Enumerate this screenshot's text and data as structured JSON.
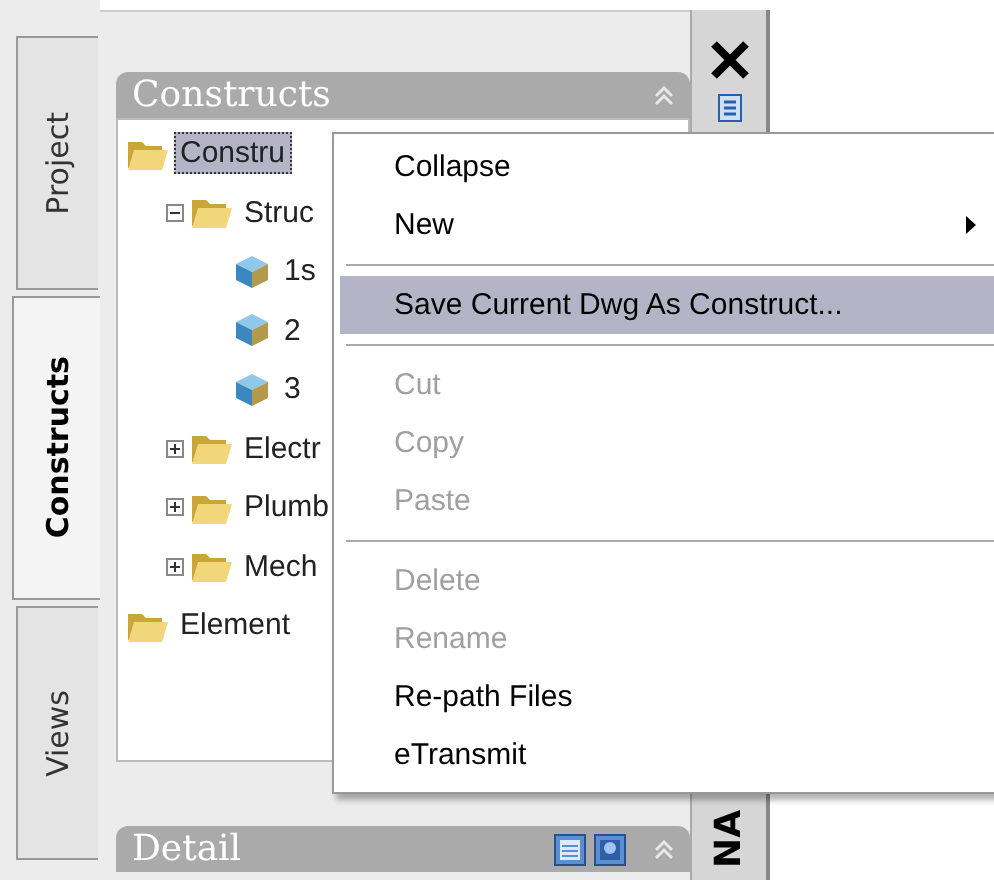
{
  "side_tabs": [
    {
      "label": "Project",
      "selected": false
    },
    {
      "label": "Constructs",
      "selected": true
    },
    {
      "label": "Views",
      "selected": false
    }
  ],
  "constructs_panel": {
    "title": "Constructs",
    "tree": [
      {
        "label": "Constru",
        "kind": "folder",
        "selected": true,
        "children": [
          {
            "label": "Struc",
            "kind": "folder",
            "selected": false,
            "expanded": true,
            "children": [
              {
                "label": "1s",
                "kind": "construct",
                "selected": false
              },
              {
                "label": "2",
                "kind": "construct",
                "selected": false
              },
              {
                "label": "3",
                "kind": "construct",
                "selected": false
              }
            ]
          },
          {
            "label": "Electr",
            "kind": "folder",
            "selected": false,
            "expanded": false
          },
          {
            "label": "Plumb",
            "kind": "folder",
            "selected": false,
            "expanded": false
          },
          {
            "label": "Mech",
            "kind": "folder",
            "selected": false,
            "expanded": false
          }
        ]
      },
      {
        "label": "Element",
        "kind": "folder",
        "selected": false
      }
    ]
  },
  "detail_panel": {
    "title": "Detail"
  },
  "side_strip": {
    "label": "NA"
  },
  "context_menu": [
    {
      "kind": "item",
      "label": "Collapse",
      "disabled": false,
      "selected": false
    },
    {
      "kind": "item",
      "label": "New",
      "disabled": false,
      "selected": false,
      "submenu": true
    },
    {
      "kind": "separator"
    },
    {
      "kind": "item",
      "label": "Save Current Dwg As Construct...",
      "disabled": false,
      "selected": true
    },
    {
      "kind": "separator"
    },
    {
      "kind": "item",
      "label": "Cut",
      "disabled": true,
      "selected": false
    },
    {
      "kind": "item",
      "label": "Copy",
      "disabled": true,
      "selected": false
    },
    {
      "kind": "item",
      "label": "Paste",
      "disabled": true,
      "selected": false
    },
    {
      "kind": "separator"
    },
    {
      "kind": "item",
      "label": "Delete",
      "disabled": true,
      "selected": false
    },
    {
      "kind": "item",
      "label": "Rename",
      "disabled": true,
      "selected": false
    },
    {
      "kind": "item",
      "label": "Re-path Files",
      "disabled": false,
      "selected": false
    },
    {
      "kind": "item",
      "label": "eTransmit",
      "disabled": false,
      "selected": false
    }
  ]
}
